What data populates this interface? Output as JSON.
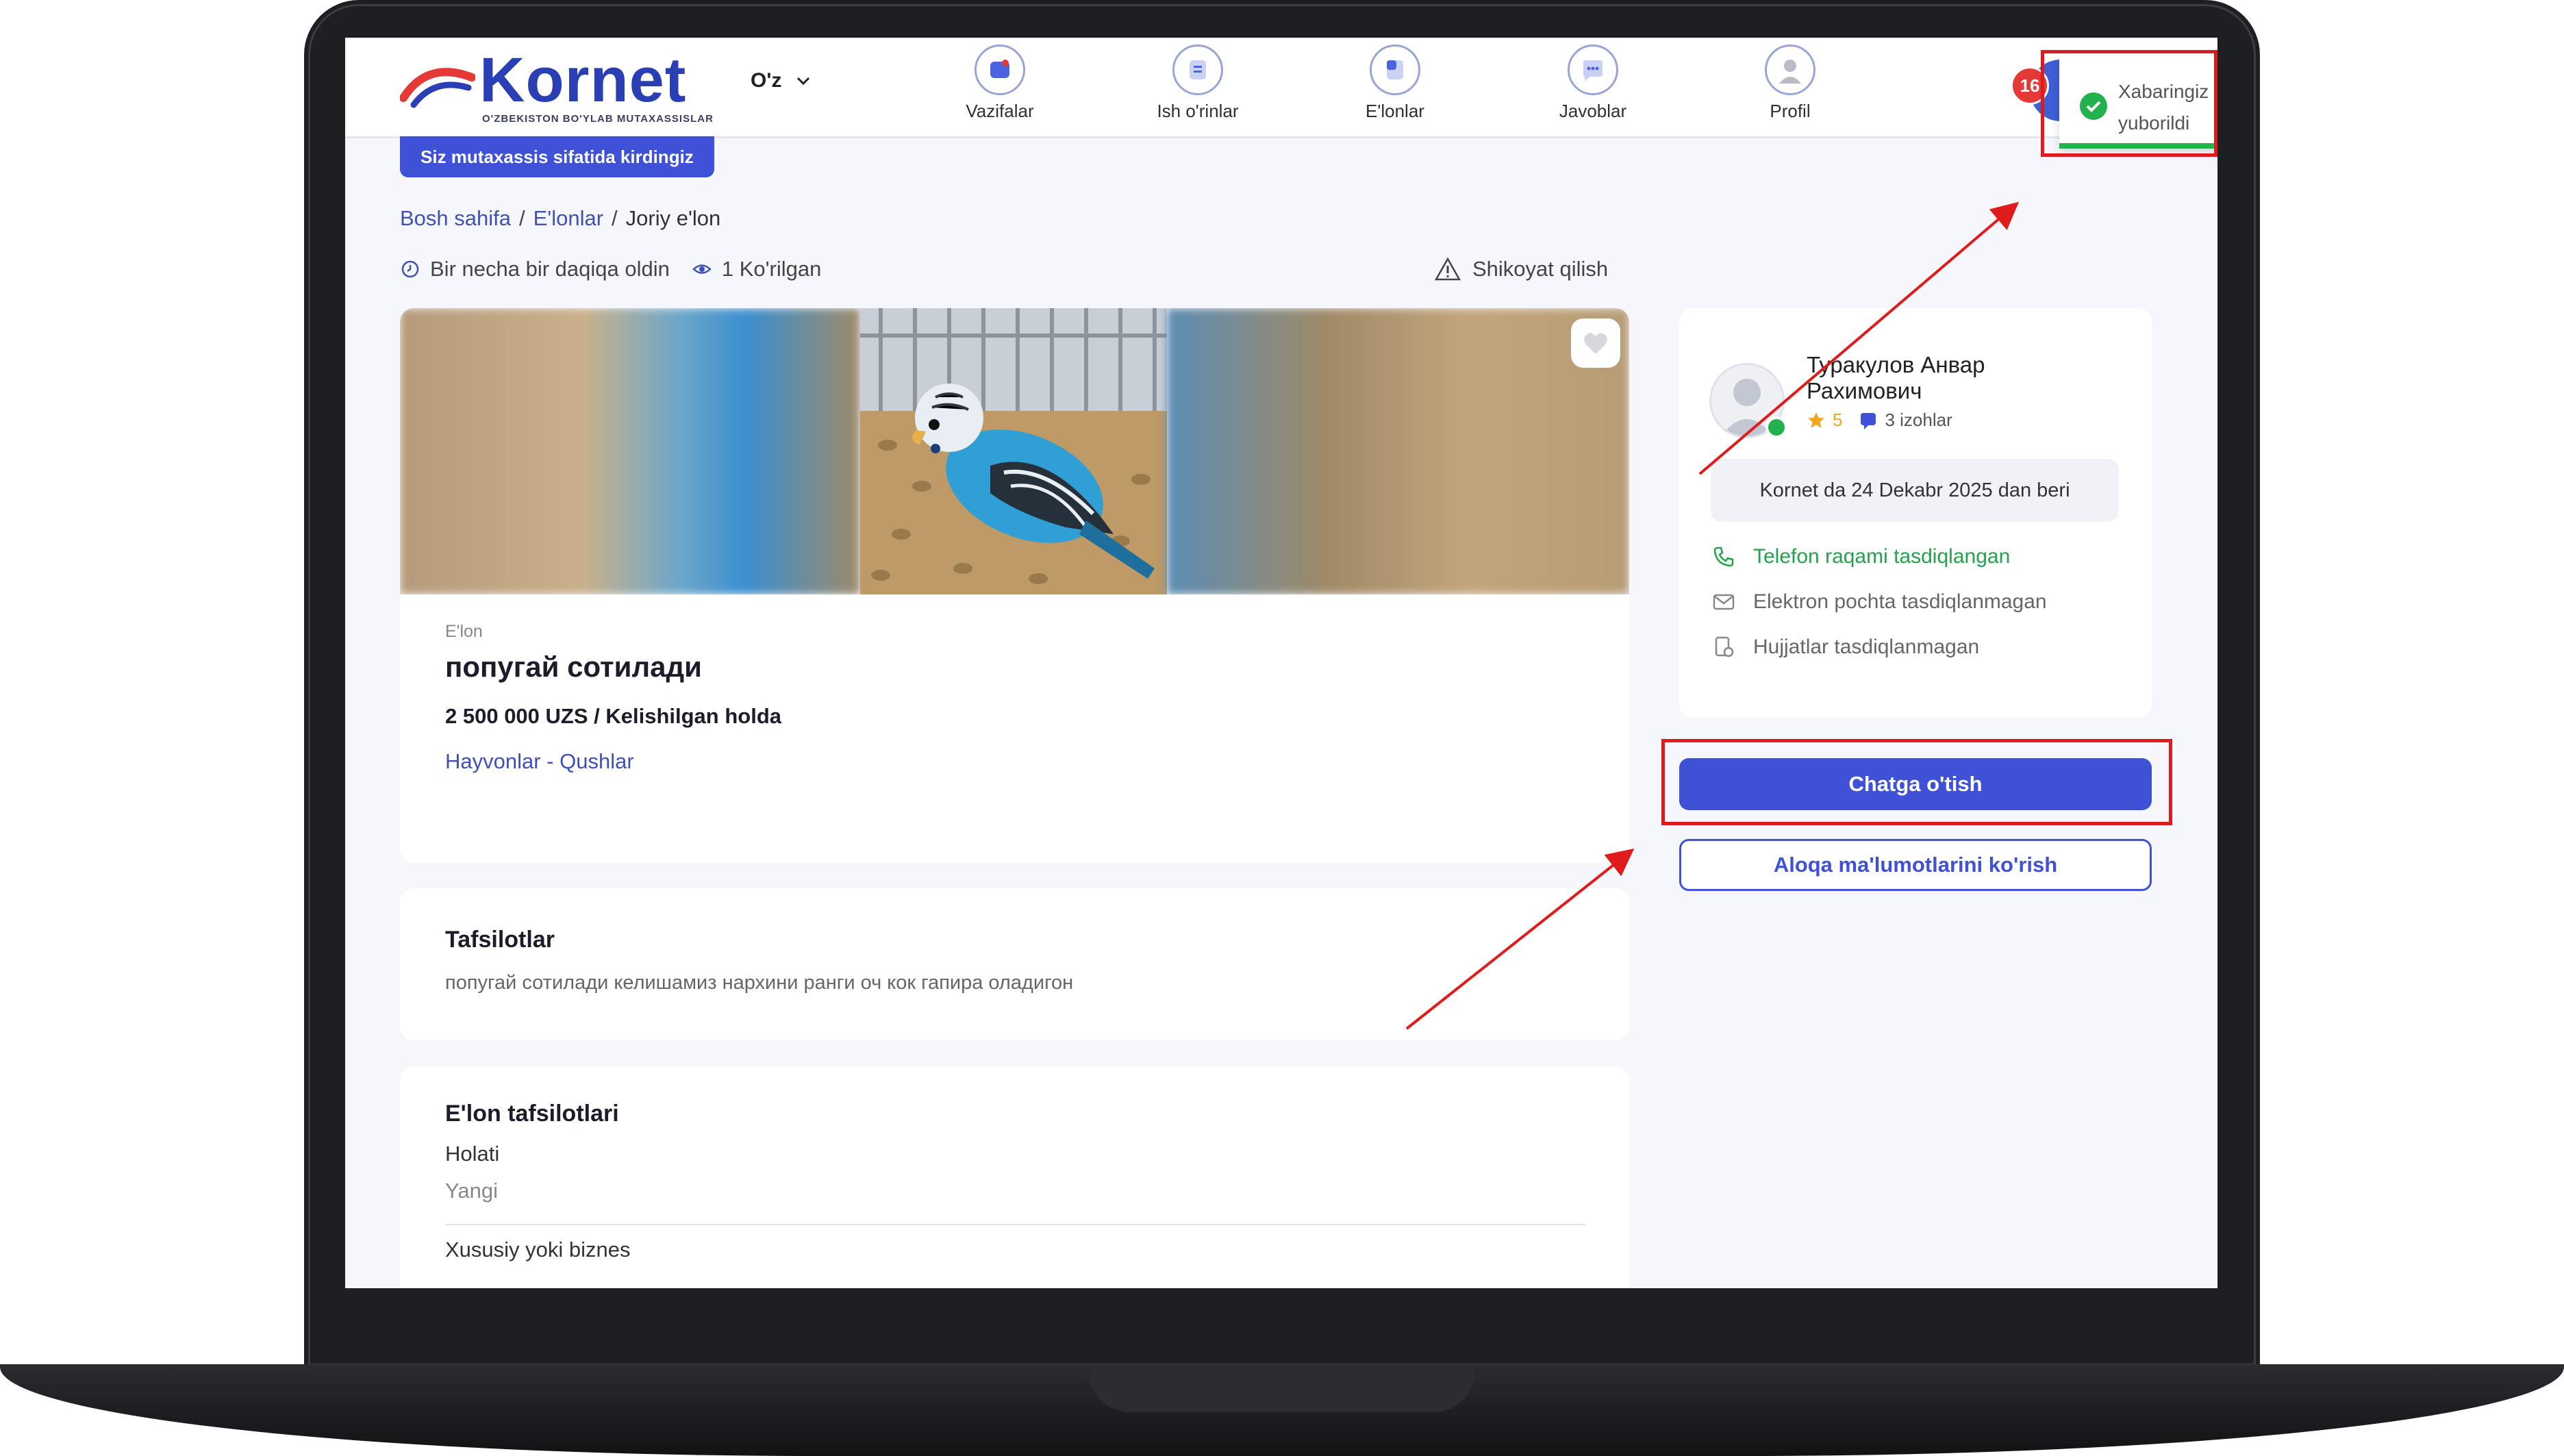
{
  "header": {
    "logo_text": "Kornet",
    "logo_subtitle": "O'ZBEKISTON BO'YLAB MUTAXASSISLAR",
    "language": "O'z",
    "nav": [
      {
        "label": "Vazifalar",
        "icon": "tasks-icon"
      },
      {
        "label": "Ish o'rinlar",
        "icon": "jobs-icon"
      },
      {
        "label": "E'lonlar",
        "icon": "ads-icon"
      },
      {
        "label": "Javoblar",
        "icon": "replies-icon"
      },
      {
        "label": "Profil",
        "icon": "profile-icon"
      }
    ],
    "notification_count": "16"
  },
  "toast": {
    "line1": "Xabaringiz",
    "line2": "yuborildi",
    "color": "#22b14c"
  },
  "role_button": "Siz mutaxassis sifatida kirdingiz",
  "breadcrumb": {
    "home": "Bosh sahifa",
    "ads": "E'lonlar",
    "current": "Joriy e'lon"
  },
  "meta": {
    "time": "Bir necha bir daqiqa oldin",
    "views": "1 Ko'rilgan",
    "complain": "Shikoyat qilish"
  },
  "listing": {
    "kind": "E'lon",
    "title": "попугай сотилади",
    "price": "2 500 000 UZS / Kelishilgan holda",
    "category": "Hayvonlar - Qushlar"
  },
  "details": {
    "heading": "Tafsilotlar",
    "text": "попугай сотилади келишамиз нархини ранги оч кок гапира оладигон"
  },
  "specs": {
    "heading": "E'lon tafsilotlari",
    "items": [
      {
        "key": "Holati",
        "value": "Yangi"
      },
      {
        "key": "Xususiy yoki biznes",
        "value": ""
      }
    ]
  },
  "seller": {
    "name": "Туракулов Анвар Рахимович",
    "rating": "5",
    "reviews": "3 izohlar",
    "since": "Kornet da 24 Dekabr 2025 dan beri",
    "phone_verified": "Telefon raqami tasdiqlangan",
    "email_status": "Elektron pochta tasdiqlanmagan",
    "docs_status": "Hujjatlar tasdiqlanmagan"
  },
  "actions": {
    "chat": "Chatga o'tish",
    "contact": "Aloqa ma'lumotlarini ko'rish"
  },
  "colors": {
    "brand": "#3f51d6",
    "highlight": "#e01b1b",
    "verified": "#22b14c"
  }
}
